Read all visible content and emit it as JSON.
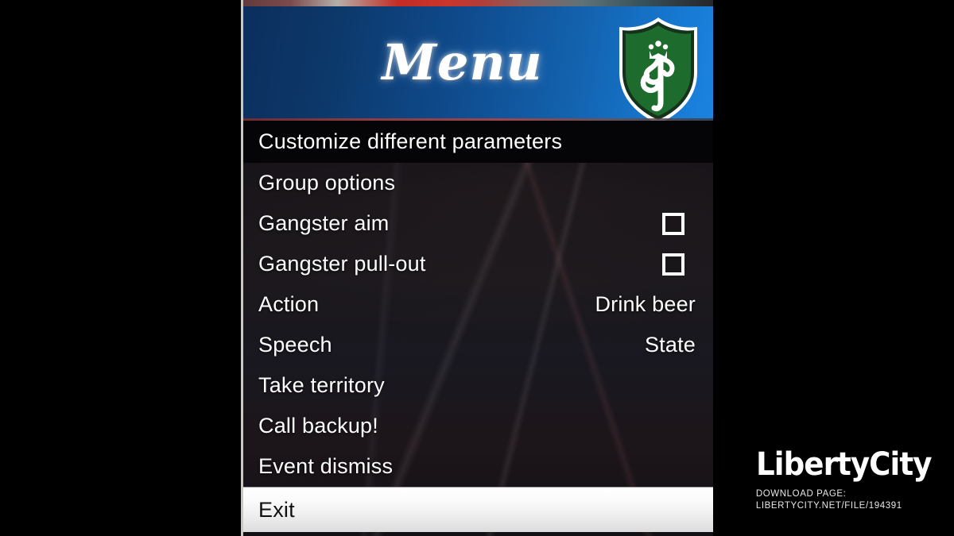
{
  "header": {
    "title": "Menu",
    "crest_icon": "green-shield-crowned-serpent-icon",
    "gradient_from": "#0b2f5e",
    "gradient_to": "#1b84e0"
  },
  "menu": {
    "items": [
      {
        "label": "Customize different parameters",
        "value": "",
        "control": "none",
        "state": "header"
      },
      {
        "label": "Group options",
        "value": "",
        "control": "none",
        "state": "normal"
      },
      {
        "label": "Gangster aim",
        "value": "",
        "control": "checkbox",
        "checked": false,
        "state": "normal"
      },
      {
        "label": "Gangster pull-out",
        "value": "",
        "control": "checkbox",
        "checked": false,
        "state": "normal"
      },
      {
        "label": "Action",
        "value": "Drink beer",
        "control": "value",
        "state": "normal"
      },
      {
        "label": "Speech",
        "value": "State",
        "control": "value",
        "state": "normal"
      },
      {
        "label": "Take territory",
        "value": "",
        "control": "none",
        "state": "normal"
      },
      {
        "label": "Call backup!",
        "value": "",
        "control": "none",
        "state": "normal"
      },
      {
        "label": "Event dismiss",
        "value": "",
        "control": "none",
        "state": "normal"
      },
      {
        "label": "Exit",
        "value": "",
        "control": "none",
        "state": "selected"
      }
    ]
  },
  "watermark": {
    "logo": "LibertyCity",
    "download_label": "DOWNLOAD PAGE:",
    "url": "LIBERTYCITY.NET/FILE/194391",
    "color": "#ffffff"
  }
}
